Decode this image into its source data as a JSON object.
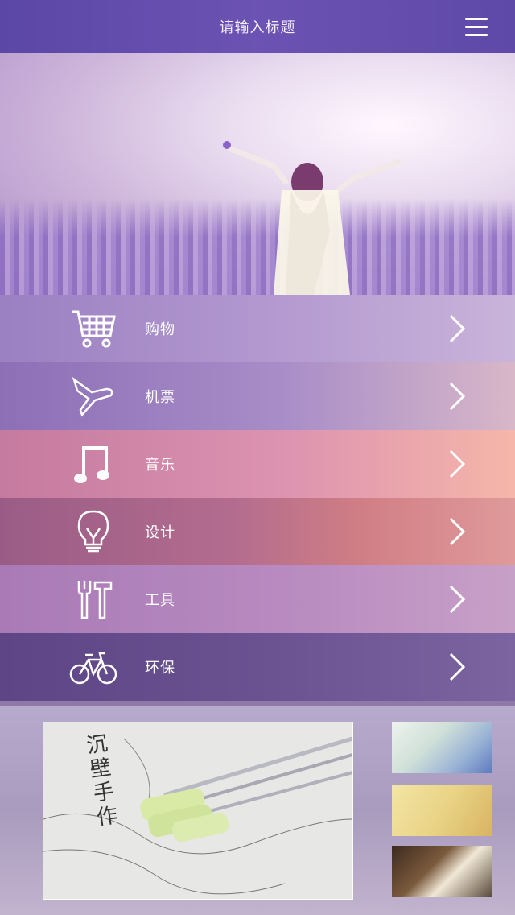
{
  "header": {
    "title": "请输入标题"
  },
  "menu": [
    {
      "label": "购物",
      "icon": "cart-icon"
    },
    {
      "label": "机票",
      "icon": "airplane-icon"
    },
    {
      "label": "音乐",
      "icon": "music-note-icon"
    },
    {
      "label": "设计",
      "icon": "lightbulb-icon"
    },
    {
      "label": "工具",
      "icon": "tools-icon"
    },
    {
      "label": "环保",
      "icon": "bicycle-icon"
    }
  ],
  "gallery": {
    "calligraphy": "沉壁手作"
  }
}
